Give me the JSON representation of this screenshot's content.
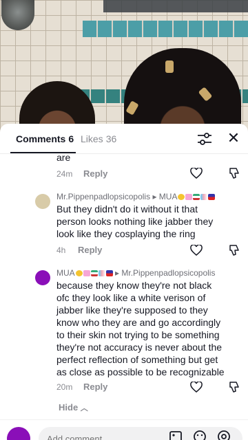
{
  "tabs": {
    "comments_label": "Comments",
    "comments_count": "6",
    "likes_label": "Likes",
    "likes_count": "36"
  },
  "comments": [
    {
      "text_lines": [
        "are"
      ],
      "time": "24m",
      "reply_label": "Reply"
    },
    {
      "author": "Mr.Pippenpadlopsicopolis",
      "reply_to": "MUA",
      "text_lines": [
        "But they didn't do it without it that",
        "person looks nothing like jabber they",
        "look like they cosplaying the ring"
      ],
      "time": "4h",
      "reply_label": "Reply"
    },
    {
      "author": "MUA",
      "reply_to": "Mr.Pippenpadlopsicopolis",
      "text_lines": [
        "because they know they're not black",
        "ofc they look like a white verison of",
        "jabber like they're supposed to they",
        "know who they are and go accordingly",
        "to their skin not trying to be something",
        "they're not accuracy is never about the",
        "perfect reflection of something but get",
        "as close as possible to be recognizable"
      ],
      "time": "20m",
      "reply_label": "Reply"
    }
  ],
  "hide_label": "Hide",
  "composer": {
    "placeholder": "Add comment..."
  },
  "icons": {
    "filter": "sliders-icon",
    "close": "close-icon",
    "like": "heart-outline-icon",
    "dislike": "thumbs-down-icon",
    "image": "image-icon",
    "emoji": "emoji-icon",
    "mention": "at-icon"
  },
  "colors": {
    "text": "#161823",
    "muted": "#8a8b91",
    "avatar_mua": "#8a0fb8"
  }
}
